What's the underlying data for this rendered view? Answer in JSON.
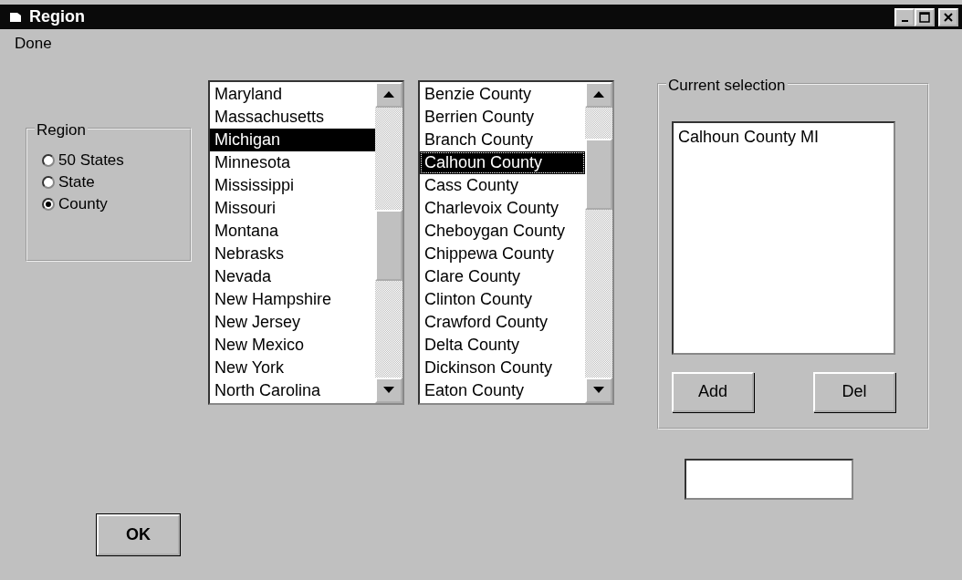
{
  "window": {
    "title": "Region"
  },
  "menu": [
    {
      "label": "Done"
    }
  ],
  "region_group": {
    "label": "Region",
    "options": [
      {
        "label": "50 States",
        "selected": false
      },
      {
        "label": "State",
        "selected": false
      },
      {
        "label": "County",
        "selected": true
      }
    ]
  },
  "states_list": {
    "items": [
      {
        "label": "Maryland",
        "selected": false
      },
      {
        "label": "Massachusetts",
        "selected": false
      },
      {
        "label": "Michigan",
        "selected": true
      },
      {
        "label": "Minnesota",
        "selected": false
      },
      {
        "label": "Mississippi",
        "selected": false
      },
      {
        "label": "Missouri",
        "selected": false
      },
      {
        "label": "Montana",
        "selected": false
      },
      {
        "label": "Nebrasks",
        "selected": false
      },
      {
        "label": "Nevada",
        "selected": false
      },
      {
        "label": "New Hampshire",
        "selected": false
      },
      {
        "label": "New Jersey",
        "selected": false
      },
      {
        "label": "New Mexico",
        "selected": false
      },
      {
        "label": "New York",
        "selected": false
      },
      {
        "label": "North Carolina",
        "selected": false
      }
    ]
  },
  "counties_list": {
    "items": [
      {
        "label": "Benzie County",
        "selected": false
      },
      {
        "label": "Berrien County",
        "selected": false
      },
      {
        "label": "Branch County",
        "selected": false
      },
      {
        "label": "Calhoun County",
        "selected": true
      },
      {
        "label": "Cass County",
        "selected": false
      },
      {
        "label": "Charlevoix County",
        "selected": false
      },
      {
        "label": "Cheboygan County",
        "selected": false
      },
      {
        "label": "Chippewa County",
        "selected": false
      },
      {
        "label": "Clare County",
        "selected": false
      },
      {
        "label": "Clinton County",
        "selected": false
      },
      {
        "label": "Crawford County",
        "selected": false
      },
      {
        "label": "Delta County",
        "selected": false
      },
      {
        "label": "Dickinson County",
        "selected": false
      },
      {
        "label": "Eaton County",
        "selected": false
      }
    ]
  },
  "current_selection": {
    "label": "Current selection",
    "items": [
      "Calhoun County MI"
    ],
    "buttons": [
      "Add",
      "Del"
    ]
  },
  "ok_button": "OK"
}
